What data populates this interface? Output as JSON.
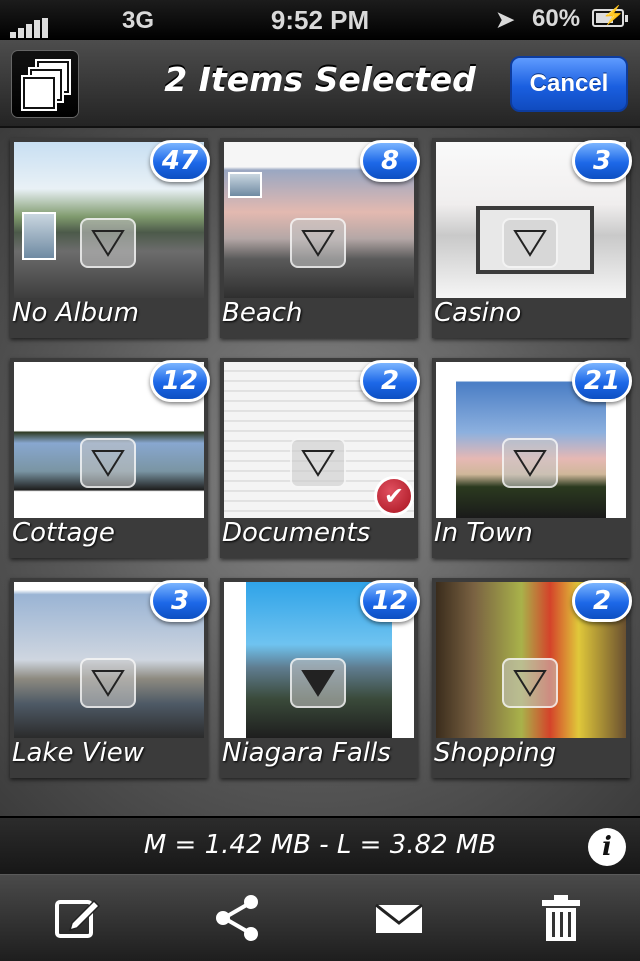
{
  "status_bar": {
    "network": "3G",
    "time": "9:52 PM",
    "battery": "60%",
    "icons": [
      "signal-bars-icon",
      "location-arrow-icon",
      "battery-charging-icon"
    ]
  },
  "nav": {
    "title": "2 Items Selected",
    "cancel_label": "Cancel",
    "left_icon": "stacked-photos-icon"
  },
  "albums": [
    {
      "name": "No Album",
      "count": "47",
      "selected": false
    },
    {
      "name": "Beach",
      "count": "8",
      "selected": false
    },
    {
      "name": "Casino",
      "count": "3",
      "selected": false
    },
    {
      "name": "Cottage",
      "count": "12",
      "selected": false
    },
    {
      "name": "Documents",
      "count": "2",
      "selected": true
    },
    {
      "name": "In Town",
      "count": "21",
      "selected": false
    },
    {
      "name": "Lake View",
      "count": "3",
      "selected": false
    },
    {
      "name": "Niagara Falls",
      "count": "12",
      "selected": false
    },
    {
      "name": "Shopping",
      "count": "2",
      "selected": false
    }
  ],
  "info_bar": {
    "text": "M = 1.42 MB - L = 3.82 MB",
    "info_label": "i"
  },
  "toolbar": {
    "icons": [
      "edit-icon",
      "share-icon",
      "mail-icon",
      "trash-icon"
    ]
  },
  "colors": {
    "badge_blue": "#1d68e8",
    "cancel_blue": "#1a5fe0",
    "check_red": "#a8121e"
  }
}
